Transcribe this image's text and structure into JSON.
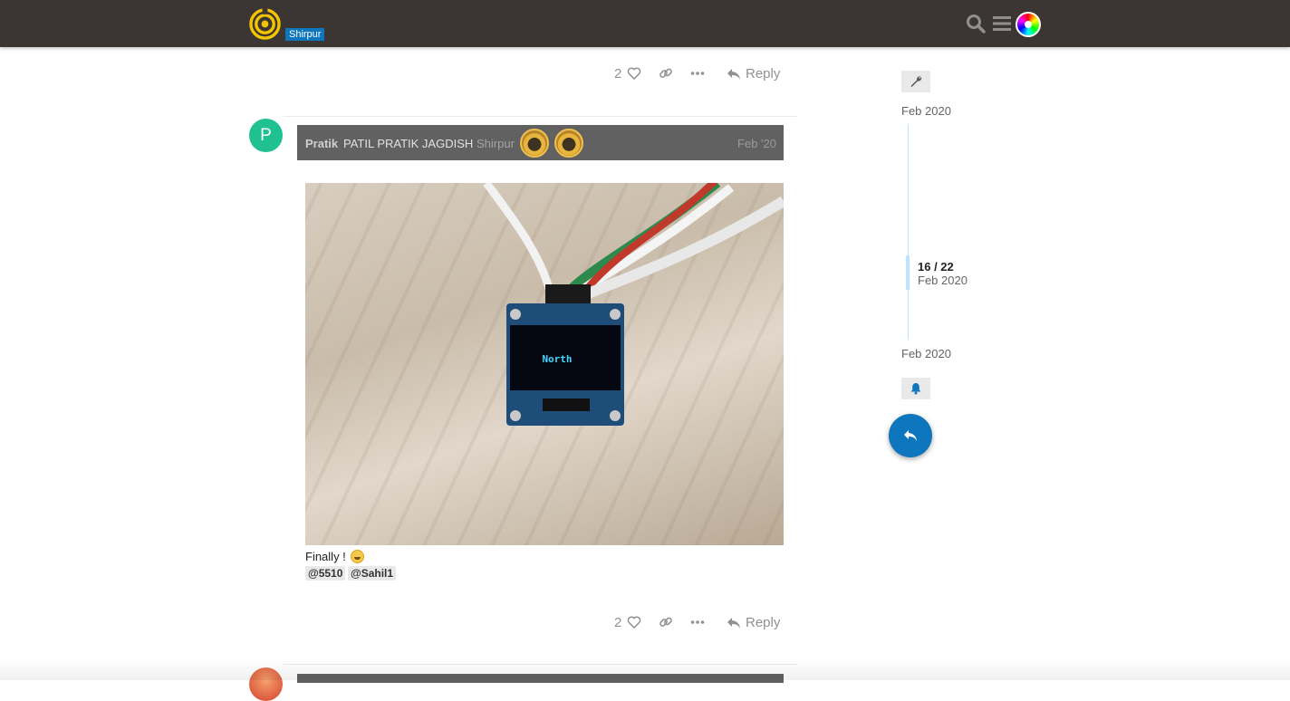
{
  "header": {
    "category_badge": "Shirpur",
    "icons": [
      "logo",
      "search-icon",
      "hamburger-menu-icon",
      "user-avatar"
    ]
  },
  "colors": {
    "header_bg": "#3b3633",
    "accent": "#0e76bd",
    "names_bar": "#616161",
    "avatar_p": "#1ec18f"
  },
  "prev_post": {
    "likes": "2",
    "reply_label": "Reply"
  },
  "post": {
    "avatar_letter": "P",
    "username": "Pratik",
    "full_name": "PATIL PRATIK JAGDISH",
    "location": "Shirpur",
    "date": "Feb '20",
    "body": "Finally !",
    "mentions": [
      "@5510",
      "@Sahil1"
    ],
    "likes": "2",
    "reply_label": "Reply",
    "photo_screen_text": "North"
  },
  "timeline": {
    "start_date": "Feb 2020",
    "position": "16 / 22",
    "position_date": "Feb 2020",
    "end_date": "Feb 2020"
  }
}
